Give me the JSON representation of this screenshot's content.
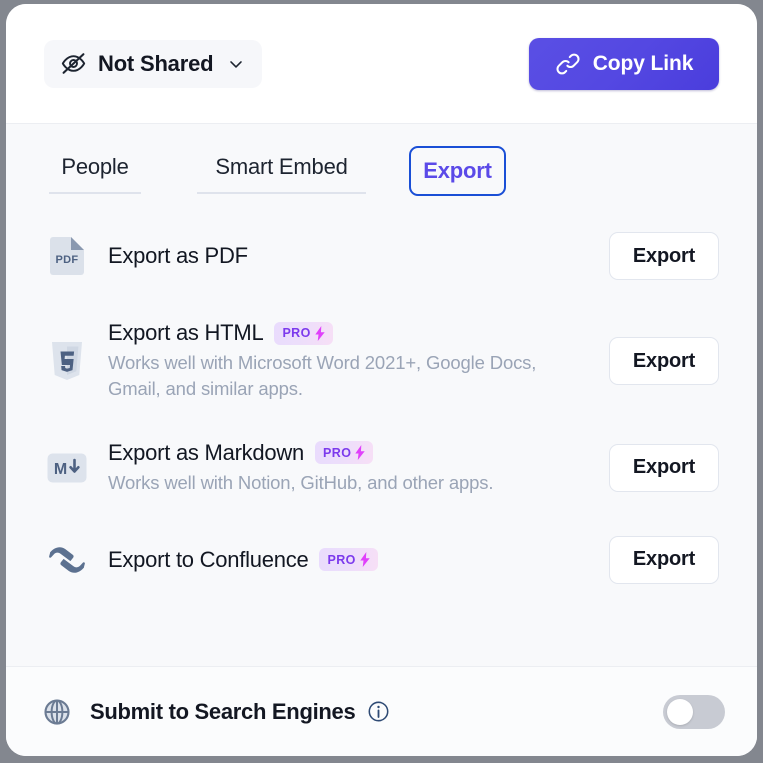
{
  "header": {
    "share_state": {
      "icon": "eye-off-icon",
      "label": "Not Shared",
      "chevron": "chevron-down-icon"
    },
    "copy_link": {
      "icon": "link-icon",
      "label": "Copy Link",
      "background": "#5448e2"
    }
  },
  "tabs": [
    {
      "label": "People",
      "active": false
    },
    {
      "label": "Smart Embed",
      "active": false
    },
    {
      "label": "Export",
      "active": true,
      "accent": "#5b4ae8",
      "ring": "#1a4fd6"
    }
  ],
  "export_rows": [
    {
      "icon": "pdf-file-icon",
      "title": "Export as PDF",
      "description": "",
      "pro": false,
      "button": "Export"
    },
    {
      "icon": "html5-shield-icon",
      "title": "Export as HTML",
      "description": "Works well with Microsoft Word 2021+, Google Docs, Gmail, and similar apps.",
      "pro": true,
      "button": "Export"
    },
    {
      "icon": "markdown-icon",
      "title": "Export as Markdown",
      "description": "Works well with Notion, GitHub, and other apps.",
      "pro": true,
      "button": "Export"
    },
    {
      "icon": "confluence-icon",
      "title": "Export to Confluence",
      "description": "",
      "pro": true,
      "button": "Export"
    }
  ],
  "pro_badge": {
    "label": "PRO",
    "bolt": "lightning-bolt-icon",
    "text_color": "#7c3aed",
    "bolt_color": "#e040fb"
  },
  "bottom_bar": {
    "icon": "globe-icon",
    "label": "Submit to Search Engines",
    "info_icon": "info-icon",
    "toggle_state": "off"
  }
}
